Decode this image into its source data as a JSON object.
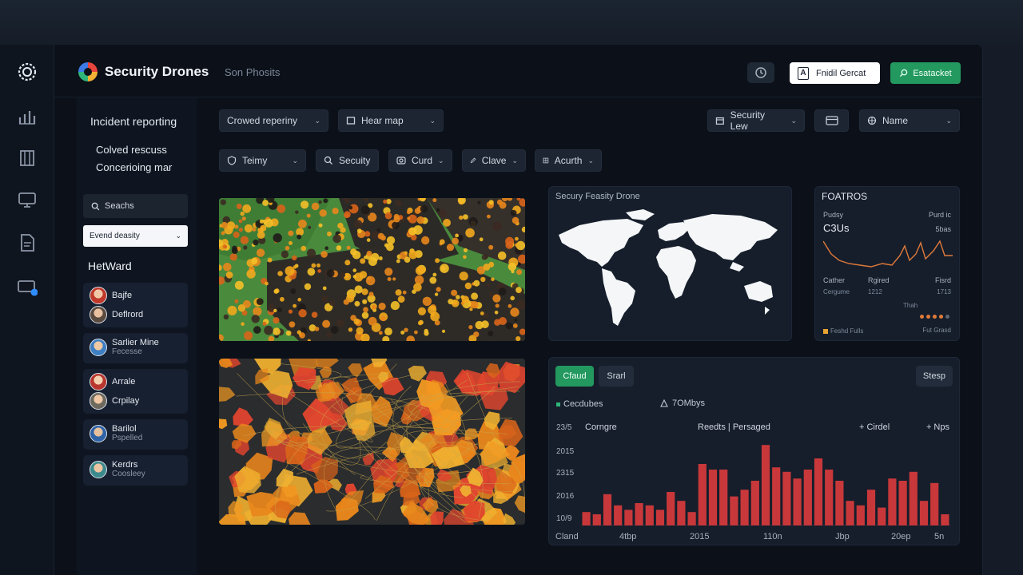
{
  "app": {
    "title": "Security Drones",
    "subtitle": "Son Phosits"
  },
  "header": {
    "clock_icon": "clock-icon",
    "white_button_letter": "A",
    "white_button_label": "Fnidil Gercat",
    "green_button_label": "Esatacket",
    "green_button_icon": "search-icon"
  },
  "rail": {
    "icons": [
      "logo-gear-icon",
      "bar-chart-icon",
      "building-icon",
      "monitor-icon",
      "document-icon",
      "display-notification-icon"
    ],
    "accent": "#2f8cff"
  },
  "left_panel": {
    "item1": "Incident reporting",
    "item2_line1": "Colved rescuss",
    "item2_line2": "Concerioing mar",
    "search_label": "Seachs",
    "select_value": "Evend deasity",
    "heading": "HetWard",
    "people": [
      {
        "name": "Bajfe",
        "role": ""
      },
      {
        "name": "Deflrord",
        "role": ""
      },
      {
        "name": "Sarlier Mine",
        "role": "Fecesse"
      },
      {
        "name": "Arrale",
        "role": ""
      },
      {
        "name": "Crpilay",
        "role": ""
      },
      {
        "name": "Barilol",
        "role": "Pspelled"
      },
      {
        "name": "Kerdrs",
        "role": "Coosleey"
      }
    ]
  },
  "filters": {
    "row1": [
      {
        "label": "Crowed reperiny",
        "icon": ""
      },
      {
        "label": "Hear map",
        "icon": "map-icon"
      }
    ],
    "row1_right": [
      {
        "label": "Security Lew",
        "icon": "calendar-icon"
      },
      {
        "label": "",
        "icon": "card-icon"
      },
      {
        "label": "Name",
        "icon": "globe-icon"
      }
    ],
    "row2": [
      {
        "label": "Teimy",
        "icon": "shield-icon"
      },
      {
        "label": "Secuity",
        "icon": "search-icon"
      },
      {
        "label": "Curd",
        "icon": "camera-icon"
      },
      {
        "label": "Clave",
        "icon": "pen-icon"
      },
      {
        "label": "Acurth",
        "icon": "grid-icon"
      }
    ]
  },
  "world_panel": {
    "title": "Secury Feasity Drone"
  },
  "stats_panel": {
    "title": "FOATROS",
    "top_left": "Pudsy",
    "top_right": "Purd ic",
    "metric": "C3Us",
    "metric_right": "5bas",
    "row1": [
      "Cather",
      "Rgired",
      "Fisrd"
    ],
    "row2": [
      "Cergume",
      "1212",
      "1713"
    ],
    "row3": "Thah",
    "legend_left": "Feshd Fulls",
    "legend_right": "Fut Grasd",
    "line_color": "#e07a3a"
  },
  "bar_panel": {
    "tab_active": "Cfaud",
    "tab_inactive": "Srarl",
    "right_button": "Stesp",
    "legend1": "Cecdubes",
    "legend2": "7OMbys",
    "header_left": "Corngre",
    "header_mid": "Reedts | Persaged",
    "header_r1": "+ Cirdel",
    "header_r2": "+ Nps",
    "y_labels": [
      "23/5",
      "2015",
      "2315",
      "2016",
      "10/9"
    ],
    "x_labels": [
      "Cland",
      "4tbp",
      "2015",
      "110n",
      "Jbp",
      "20ep",
      "5n"
    ],
    "bar_color": "#c8383a"
  },
  "chart_data": {
    "type": "bar",
    "values": [
      12,
      10,
      28,
      18,
      14,
      20,
      18,
      14,
      30,
      22,
      12,
      55,
      50,
      50,
      26,
      32,
      40,
      72,
      52,
      48,
      42,
      50,
      60,
      50,
      40,
      22,
      18,
      32,
      16,
      42,
      40,
      48,
      22,
      38,
      10
    ]
  }
}
